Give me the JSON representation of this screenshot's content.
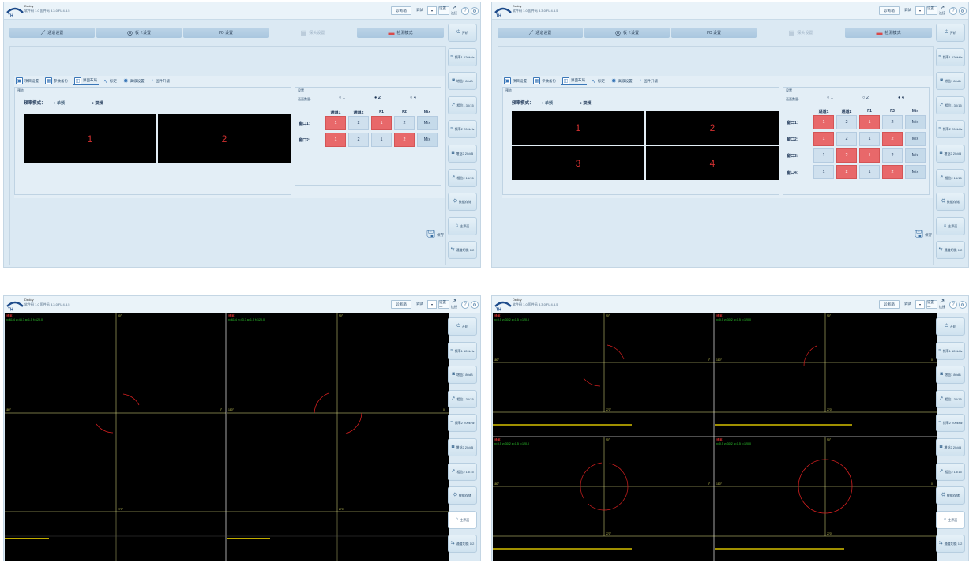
{
  "header": {
    "brand": "Deddy",
    "version": "软件码 1.0 固件码 3.3.0 FL 4.5.5",
    "button_label": "诊断箱",
    "mode_label": "调试",
    "selector_value": "设置一",
    "link_label": "连接"
  },
  "toolbar": {
    "channel": "通道设置",
    "card": "板卡设置",
    "io": "I/O 设置",
    "probe": "探头设置",
    "detect": "检测模式"
  },
  "sidebar": {
    "items": [
      "开机",
      "频率1 120kHz",
      "增益1 80dB",
      "相位1 30/15",
      "频率2 200kHz",
      "增益2 20/dB",
      "相位2 15/15",
      "数据存储",
      "主界面",
      "通道切换 1/2"
    ]
  },
  "settings": {
    "tabs": [
      "项目设置",
      "参数备份",
      "界面布局",
      "标定",
      "高级设置",
      "固件升级"
    ],
    "preview_label": "预览",
    "set_label": "设置",
    "freq_mode_label": "频率模式：",
    "freq_single": "单频",
    "freq_dual": "双频",
    "window_count_label": "画面数量:",
    "counts": [
      "1",
      "2",
      "4"
    ],
    "columns": [
      "通道1",
      "通道2",
      "F1",
      "F2",
      "Mix"
    ],
    "save_label": "保存",
    "layout_a": {
      "selected_count": "2",
      "tiles": [
        "1",
        "2"
      ],
      "rows": [
        {
          "label": "窗口1：",
          "cells": [
            "1",
            "2",
            "1",
            "2",
            "Mix"
          ],
          "hi": [
            true,
            false,
            true,
            false,
            false
          ]
        },
        {
          "label": "窗口2：",
          "cells": [
            "1",
            "2",
            "1",
            "2",
            "Mix"
          ],
          "hi": [
            true,
            false,
            false,
            true,
            false
          ]
        }
      ]
    },
    "layout_b": {
      "selected_count": "4",
      "tiles": [
        "1",
        "2",
        "3",
        "4"
      ],
      "rows": [
        {
          "label": "窗口1：",
          "cells": [
            "1",
            "2",
            "1",
            "2",
            "Mix"
          ],
          "hi": [
            true,
            false,
            true,
            false,
            false
          ]
        },
        {
          "label": "窗口2：",
          "cells": [
            "1",
            "2",
            "1",
            "2",
            "Mix"
          ],
          "hi": [
            true,
            false,
            false,
            true,
            false
          ]
        },
        {
          "label": "窗口3：",
          "cells": [
            "1",
            "2",
            "1",
            "2",
            "Mix"
          ],
          "hi": [
            false,
            true,
            true,
            false,
            false
          ]
        },
        {
          "label": "窗口4：",
          "cells": [
            "1",
            "2",
            "1",
            "2",
            "Mix"
          ],
          "hi": [
            false,
            true,
            false,
            true,
            false
          ]
        }
      ]
    }
  },
  "scopes": {
    "two_view": [
      {
        "channel": "通道1",
        "readout": "x=61.4  y=43.7  a=1.5  f=120.0",
        "deg_top": "90°",
        "deg_left": "180°",
        "deg_right": "0°",
        "deg_bottom": "270°"
      },
      {
        "channel": "通道1",
        "readout": "x=61.4  y=43.7  a=1.5  f=120.0",
        "deg_top": "90°",
        "deg_left": "180°",
        "deg_right": "0°",
        "deg_bottom": "270°"
      }
    ],
    "four_view": [
      {
        "channel": "通道1",
        "readout": "x=0.5  y=30.2  a=1.5  f=120.0",
        "deg_top": "90°",
        "deg_left": "180°",
        "deg_right": "0°",
        "deg_bottom": "270°"
      },
      {
        "channel": "通道1",
        "readout": "x=0.5  y=30.2  a=1.5  f=120.0",
        "deg_top": "90°",
        "deg_left": "180°",
        "deg_right": "0°",
        "deg_bottom": "270°"
      },
      {
        "channel": "通道1",
        "readout": "x=0.5  y=30.2  a=1.5  f=120.0",
        "deg_top": "90°",
        "deg_left": "180°",
        "deg_right": "0°",
        "deg_bottom": "270°"
      },
      {
        "channel": "通道1",
        "readout": "x=0.5  y=30.2  a=1.5  f=120.0",
        "deg_top": "90°",
        "deg_left": "180°",
        "deg_right": "0°",
        "deg_bottom": "270°"
      }
    ]
  },
  "colors": {
    "accent": "#3a77b8",
    "highlight": "#e8686a",
    "trace": "#d42020",
    "axis": "#e6e68a"
  }
}
